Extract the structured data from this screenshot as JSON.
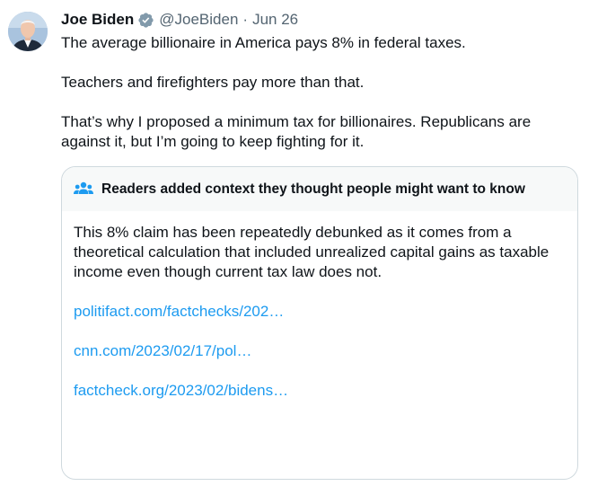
{
  "tweet": {
    "display_name": "Joe Biden",
    "handle": "@JoeBiden",
    "separator": "·",
    "date": "Jun 26",
    "text_lines": [
      "The average billionaire in America pays 8% in federal taxes.",
      "Teachers and firefighters pay more than that.",
      "That’s why I proposed a minimum tax for billionaires. Republicans are against it, but I’m going to keep fighting for it."
    ]
  },
  "community_note": {
    "title": "Readers added context they thought people might want to know",
    "body": "This 8% claim has been repeatedly debunked as it comes from a theoretical calculation that included unrealized capital gains as taxable income even though current tax law does not.",
    "links": [
      "politifact.com/factchecks/202…",
      "cnn.com/2023/02/17/pol…",
      "factcheck.org/2023/02/bidens…"
    ]
  },
  "colors": {
    "text": "#0f1419",
    "secondary": "#536471",
    "link": "#1d9bf0",
    "verified": "#829aab",
    "note_header_bg": "#f7f9f9",
    "border": "#cfd9de"
  },
  "icons": {
    "avatar": "avatar",
    "verified": "verified-badge-icon",
    "note": "people-icon"
  }
}
